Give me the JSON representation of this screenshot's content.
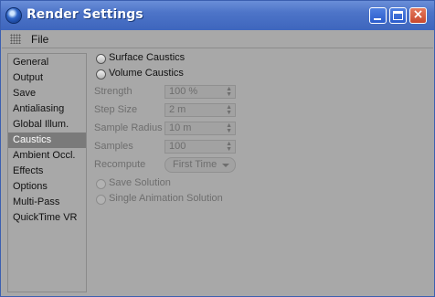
{
  "window": {
    "title": "Render Settings"
  },
  "menubar": {
    "file": "File"
  },
  "sidebar": {
    "items": [
      {
        "label": "General"
      },
      {
        "label": "Output"
      },
      {
        "label": "Save"
      },
      {
        "label": "Antialiasing"
      },
      {
        "label": "Global Illum."
      },
      {
        "label": "Caustics",
        "selected": true
      },
      {
        "label": "Ambient Occl."
      },
      {
        "label": "Effects"
      },
      {
        "label": "Options"
      },
      {
        "label": "Multi-Pass"
      },
      {
        "label": "QuickTime VR"
      }
    ]
  },
  "caustics": {
    "surface_caustics": {
      "label": "Surface Caustics",
      "checked": false
    },
    "volume_caustics": {
      "label": "Volume Caustics",
      "checked": false
    },
    "strength": {
      "label": "Strength",
      "value": "100 %"
    },
    "step_size": {
      "label": "Step Size",
      "value": "2 m"
    },
    "sample_radius": {
      "label": "Sample Radius",
      "value": "10 m"
    },
    "samples": {
      "label": "Samples",
      "value": "100"
    },
    "recompute": {
      "label": "Recompute",
      "value": "First Time"
    },
    "save_solution": {
      "label": "Save Solution",
      "checked": false
    },
    "single_animation_solution": {
      "label": "Single Animation Solution",
      "checked": false
    }
  }
}
